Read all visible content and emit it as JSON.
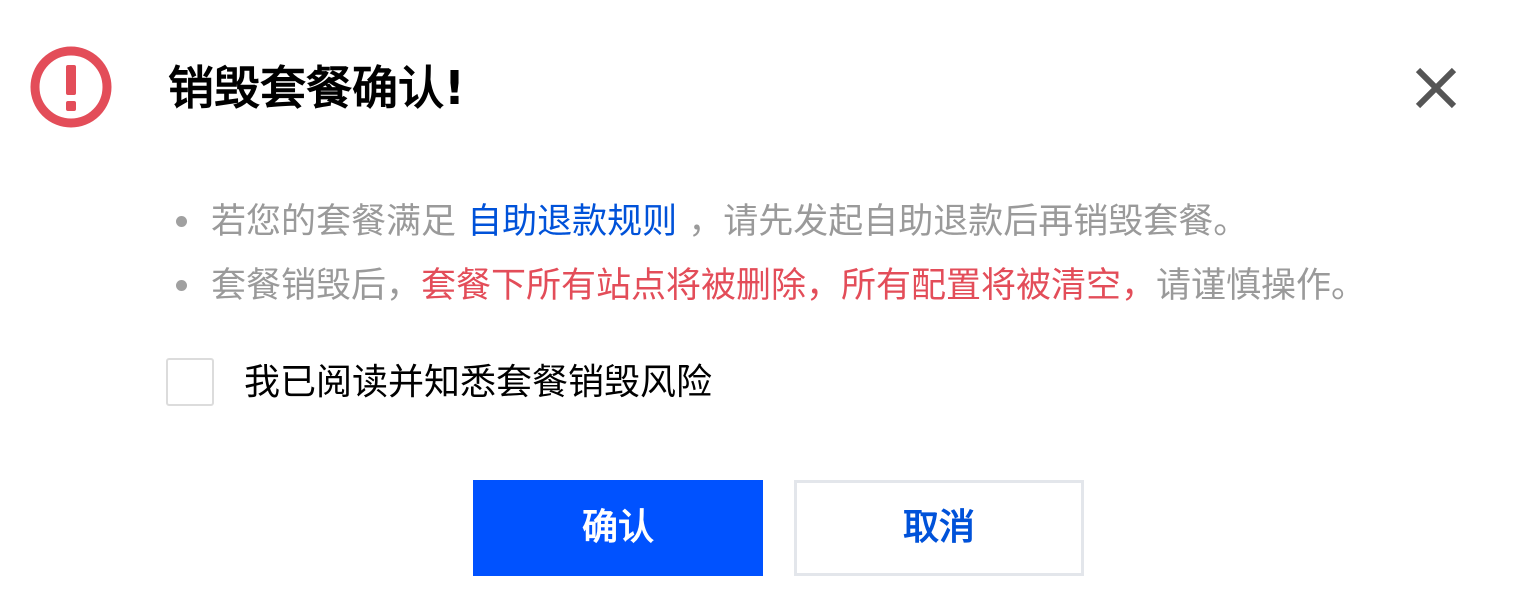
{
  "dialog": {
    "title": "销毁套餐确认!",
    "icon": "warning-circle-icon",
    "icon_color": "#e34d59"
  },
  "bullets": [
    {
      "prefix": "若您的套餐满足 ",
      "link": "自助退款规则",
      "suffix": " ，请先发起自助退款后再销毁套餐。"
    },
    {
      "prefix": "套餐销毁后，",
      "danger": "套餐下所有站点将被删除，所有配置将被清空，",
      "suffix": "请谨慎操作。"
    }
  ],
  "checkbox": {
    "label": "我已阅读并知悉套餐销毁风险",
    "checked": false
  },
  "buttons": {
    "confirm": "确认",
    "cancel": "取消"
  },
  "colors": {
    "primary": "#0052ff",
    "link": "#0052d9",
    "danger": "#e34d59",
    "muted_text": "#9a9a9a"
  }
}
